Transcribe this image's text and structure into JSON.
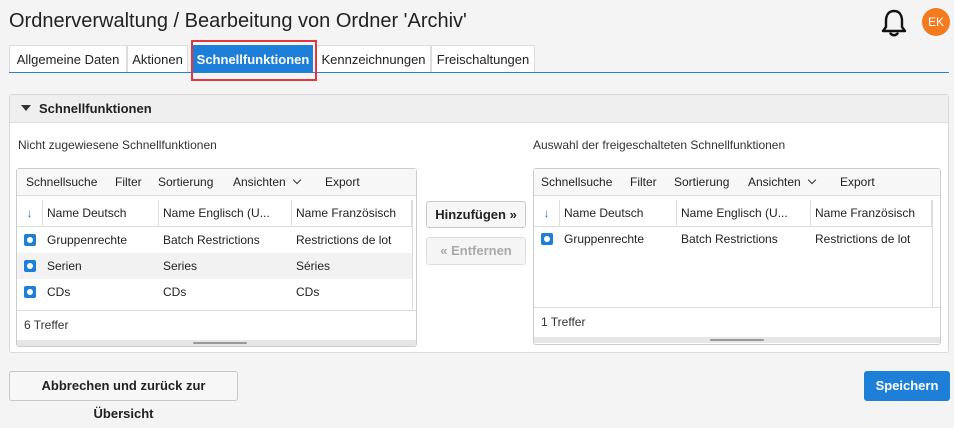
{
  "page": {
    "title": "Ordnerverwaltung / Bearbeitung von Ordner 'Archiv'"
  },
  "user": {
    "initials": "EK",
    "avatar_color": "#f47a20"
  },
  "tabs": [
    {
      "label": "Allgemeine Daten",
      "active": false
    },
    {
      "label": "Aktionen",
      "active": false
    },
    {
      "label": "Schnellfunktionen",
      "active": true
    },
    {
      "label": "Kennzeichnungen",
      "active": false
    },
    {
      "label": "Freischaltungen",
      "active": false
    }
  ],
  "panel": {
    "title": "Schnellfunktionen"
  },
  "toolbar": {
    "quicksearch": "Schnellsuche",
    "filter": "Filter",
    "sort": "Sortierung",
    "views": "Ansichten",
    "export": "Export"
  },
  "left_list": {
    "title": "Nicht zugewiesene Schnellfunktionen",
    "columns": [
      "Name Deutsch",
      "Name Englisch (U...",
      "Name Französisch"
    ],
    "rows": [
      [
        "Gruppenrechte",
        "Batch Restrictions",
        "Restrictions de lot"
      ],
      [
        "Serien",
        "Series",
        "Séries"
      ],
      [
        "CDs",
        "CDs",
        "CDs"
      ]
    ],
    "count": "6 Treffer"
  },
  "right_list": {
    "title": "Auswahl der freigeschalteten Schnellfunktionen",
    "columns": [
      "Name Deutsch",
      "Name Englisch (U...",
      "Name Französisch"
    ],
    "rows": [
      [
        "Gruppenrechte",
        "Batch Restrictions",
        "Restrictions de lot"
      ]
    ],
    "count": "1 Treffer"
  },
  "actions": {
    "add": "Hinzufügen »",
    "remove": "« Entfernen",
    "cancel": "Abbrechen und zurück zur Übersicht",
    "save": "Speichern"
  },
  "colors": {
    "accent": "#1e7fd9",
    "highlight": "#e0383e"
  },
  "icons": [
    "bell-icon",
    "sort-arrow-icon",
    "chevron-down-icon",
    "row-type-icon"
  ]
}
